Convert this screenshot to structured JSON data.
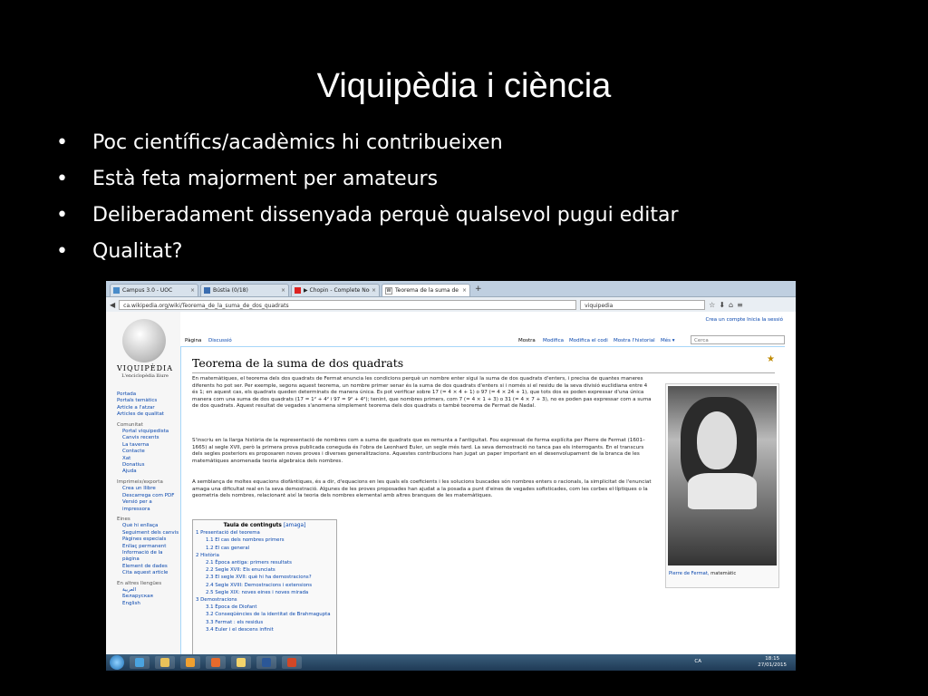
{
  "slide": {
    "title": "Viquipèdia i ciència",
    "bullets": [
      "Poc científics/acadèmics hi contribueixen",
      "Està feta majorment per amateurs",
      "Deliberadament dissenyada perquè qualsevol pugui editar",
      "Qualitat?"
    ]
  },
  "browser": {
    "tabs": [
      {
        "label": "Campus 3.0 - UOC",
        "icon": "campus-icon"
      },
      {
        "label": "Bústia (0/18)",
        "icon": "mail-icon"
      },
      {
        "label": "▶ Chopin - Complete Noc...",
        "icon": "youtube-icon"
      },
      {
        "label": "Teorema de la suma de do...",
        "icon": "wikipedia-icon"
      }
    ],
    "url": "ca.wikipedia.org/wiki/Teorema_de_la_suma_de_dos_quadrats",
    "search": "viquipedia"
  },
  "wiki": {
    "logo_title": "VIQUIPÈDIA",
    "logo_sub": "L'enciclopèdia lliure",
    "personal": "Crea un compte   Inicia la sessió",
    "tabs_left": [
      "Pàgina",
      "Discussió"
    ],
    "tabs_right": [
      "Mostra",
      "Modifica",
      "Modifica el codi",
      "Mostra l'historial",
      "Més ▾"
    ],
    "search_placeholder": "Cerca",
    "nav": [
      {
        "t": "lnk",
        "v": "Portada"
      },
      {
        "t": "lnk",
        "v": "Portals temàtics"
      },
      {
        "t": "lnk",
        "v": "Article a l'atzar"
      },
      {
        "t": "lnk",
        "v": "Articles de qualitat"
      },
      {
        "t": "hd",
        "v": "Comunitat"
      },
      {
        "t": "lnk ind",
        "v": "Portal viquipedista"
      },
      {
        "t": "lnk ind",
        "v": "Canvis recents"
      },
      {
        "t": "lnk ind",
        "v": "La taverna"
      },
      {
        "t": "lnk ind",
        "v": "Contacte"
      },
      {
        "t": "lnk ind",
        "v": "Xat"
      },
      {
        "t": "lnk ind",
        "v": "Donatius"
      },
      {
        "t": "lnk ind",
        "v": "Ajuda"
      },
      {
        "t": "hd",
        "v": "Imprimeix/exporta"
      },
      {
        "t": "lnk ind",
        "v": "Crea un llibre"
      },
      {
        "t": "lnk ind",
        "v": "Descarrega com PDF"
      },
      {
        "t": "lnk ind",
        "v": "Versió per a"
      },
      {
        "t": "lnk ind",
        "v": "impressora"
      },
      {
        "t": "hd",
        "v": "Eines"
      },
      {
        "t": "lnk ind",
        "v": "Què hi enllaça"
      },
      {
        "t": "lnk ind",
        "v": "Seguiment dels canvis"
      },
      {
        "t": "lnk ind",
        "v": "Pàgines especials"
      },
      {
        "t": "lnk ind",
        "v": "Enllaç permanent"
      },
      {
        "t": "lnk ind",
        "v": "Informació de la"
      },
      {
        "t": "lnk ind",
        "v": "pàgina"
      },
      {
        "t": "lnk ind",
        "v": "Element de dades"
      },
      {
        "t": "lnk ind",
        "v": "Cita aquest article"
      },
      {
        "t": "hd",
        "v": "En altres llengües"
      },
      {
        "t": "lnk ind",
        "v": "العربية"
      },
      {
        "t": "lnk ind",
        "v": "Беларуская"
      },
      {
        "t": "lnk ind",
        "v": "English"
      }
    ],
    "article_title": "Teorema de la suma de dos quadrats",
    "paragraphs": [
      "En matemàtiques, el teorema dels dos quadrats de Fermat enuncia les condicions perquè un nombre enter sigui la suma de dos quadrats d'enters, i precisa de quantes maneres diferents ho pot ser. Per exemple, segons aquest teorema, un nombre primer senar és la suma de dos quadrats d'enters si i només si el residu de la seva divisió euclidiana entre 4 és 1; en aquest cas, els quadrats queden determinats de manera única. Es pot verificar sobre 17 (= 4 × 4 + 1) o 97 (= 4 × 24 + 1), que tots dos es poden expressar d'una única manera com una suma de dos quadrats (17 = 1² + 4² i 97 = 9² + 4²); tenint, que nombres primers, com 7 (= 4 × 1 + 3) o 31 (= 4 × 7 + 3), no es poden pas expressar com a suma de dos quadrats. Aquest resultat de vegades s'anomena simplement teorema dels dos quadrats o també teorema de Fermat de Nadal.",
      "S'inscriu en la llarga història de la representació de nombres com a suma de quadrats que es remunta a l'antiguitat. Fou expressat de forma explícita per Pierre de Fermat (1601–1665) al segle XVII, però la primera prova publicada coneguda és l'obra de Leonhard Euler, un segle més tard. La seva demostració no tanca pas els interrogants. En el transcurs dels segles posteriors es proposaren noves proves i diverses generalitzacions. Aquestes contribucions han jugat un paper important en el desenvolupament de la branca de les matemàtiques anomenada teoria algebraica dels nombres.",
      "A semblança de moltes equacions diofàntiques, és a dir, d'equacions en les quals els coeficients i les solucions buscades són nombres enters o racionals, la simplicitat de l'enunciat amaga una dificultat real en la seva demostració. Algunes de les proves proposades han ajudat a la posada a punt d'eines de vegades sofisticades, com les corbes el·líptiques o la geometria dels nombres, relacionant així la teoria dels nombres elemental amb altres branques de les matemàtiques."
    ],
    "image_caption_link": "Pierre de Fermat,",
    "image_caption_rest": " matemàtic",
    "toc_title": "Taula de continguts",
    "toc_hide": "[amaga]",
    "toc": [
      {
        "lvl": 1,
        "v": "1 Presentació del teorema"
      },
      {
        "lvl": 2,
        "v": "1.1 El cas dels nombres primers"
      },
      {
        "lvl": 2,
        "v": "1.2 El cas general"
      },
      {
        "lvl": 1,
        "v": "2 Història"
      },
      {
        "lvl": 2,
        "v": "2.1 Època antiga: primers resultats"
      },
      {
        "lvl": 2,
        "v": "2.2 Segle XVII: Els enunciats"
      },
      {
        "lvl": 2,
        "v": "2.3 El segle XVII: què hi ha demostracions?"
      },
      {
        "lvl": 2,
        "v": "2.4 Segle XVIII: Demostracions i extensions"
      },
      {
        "lvl": 2,
        "v": "2.5 Segle XIX: noves eines i noves mirada"
      },
      {
        "lvl": 1,
        "v": "3 Demostracions"
      },
      {
        "lvl": 2,
        "v": "3.1 Època de Diofant"
      },
      {
        "lvl": 2,
        "v": "3.2 Conseqüències de la identitat de Brahmagupta"
      },
      {
        "lvl": 2,
        "v": "3.3 Fermat : els residus"
      },
      {
        "lvl": 2,
        "v": "3.4 Euler i el descens infinit"
      }
    ]
  },
  "taskbar": {
    "lang": "CA",
    "time": "18:15",
    "date": "27/01/2015",
    "apps": [
      {
        "name": "ie-icon",
        "color": "#4aa3df"
      },
      {
        "name": "explorer-icon",
        "color": "#e8c15a"
      },
      {
        "name": "media-player-icon",
        "color": "#f0a030"
      },
      {
        "name": "firefox-icon",
        "color": "#e66a2c"
      },
      {
        "name": "folder-icon",
        "color": "#f3d36b"
      },
      {
        "name": "word-icon",
        "color": "#2b5797"
      },
      {
        "name": "powerpoint-icon",
        "color": "#d24726"
      }
    ]
  }
}
